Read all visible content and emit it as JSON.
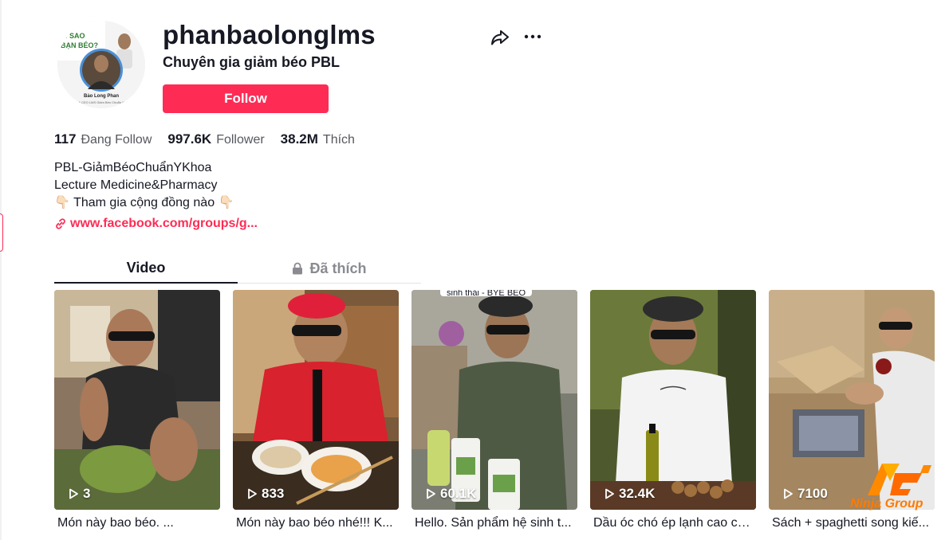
{
  "profile": {
    "username": "phanbaolonglms",
    "nickname": "Chuyên gia giảm béo PBL",
    "follow_label": "Follow",
    "avatar_icon": "avatar-image"
  },
  "actions": {
    "share_icon": "share-icon",
    "more_icon": "more-horizontal-icon"
  },
  "stats": {
    "following_count": "117",
    "following_label": "Đang Follow",
    "followers_count": "997.6K",
    "followers_label": "Follower",
    "likes_count": "38.2M",
    "likes_label": "Thích"
  },
  "bio": {
    "line1": "PBL-GiảmBéoChuẩnYKhoa",
    "line2": "Lecture Medicine&Pharmacy",
    "line3": "👇🏻 Tham gia cộng đồng nào 👇🏻",
    "link": "www.facebook.com/groups/g..."
  },
  "tabs": {
    "video": "Video",
    "liked": "Đã thích"
  },
  "videos": [
    {
      "views": "3",
      "caption": "Món này bao béo. ..."
    },
    {
      "views": "833",
      "caption": "Món này bao béo nhé!!! K..."
    },
    {
      "views": "60.1K",
      "caption": "Hello. Sản phẩm hệ sinh t...",
      "overlay": "sinh thái - BYE BÉO"
    },
    {
      "views": "32.4K",
      "caption": "Dầu óc chó ép lạnh cao cấ..."
    },
    {
      "views": "7100",
      "caption": "Sách + spaghetti song kiế..."
    }
  ],
  "watermark": {
    "text": "Ninja Group"
  },
  "colors": {
    "primary": "#fe2c55",
    "text": "#161823",
    "secondary_text": "#56575e",
    "watermark": "#ff7a00"
  }
}
